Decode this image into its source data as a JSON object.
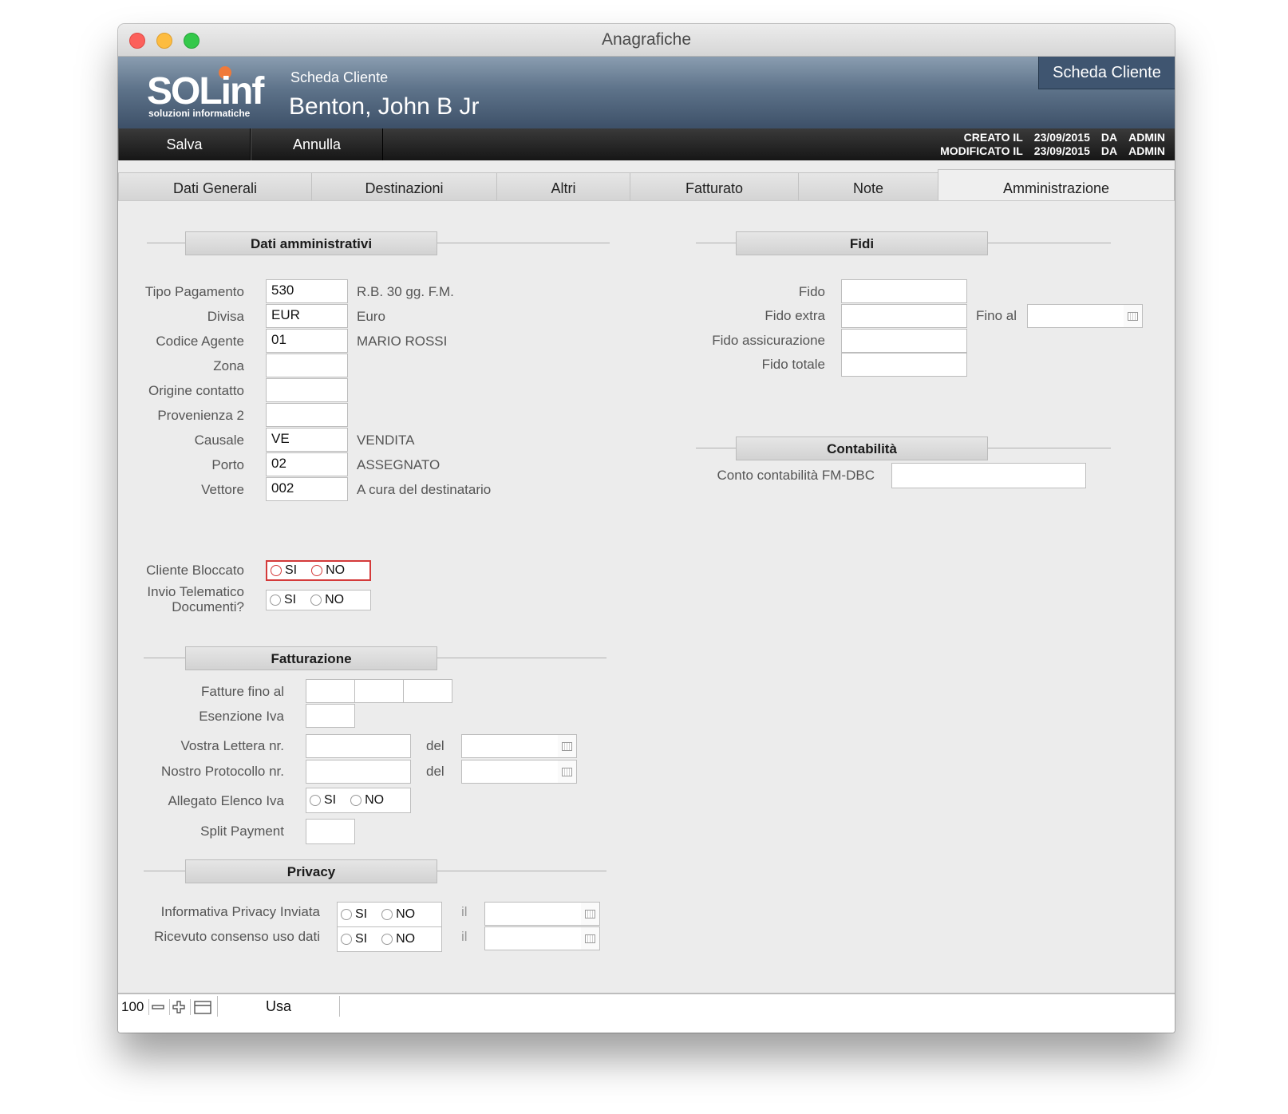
{
  "window": {
    "title": "Anagrafiche"
  },
  "banner": {
    "logo_text": "SOLinf",
    "logo_sub": "soluzioni informatiche",
    "subtitle": "Scheda Cliente",
    "name": "Benton, John B Jr",
    "badge": "Scheda Cliente"
  },
  "toolbar": {
    "save_label": "Salva",
    "cancel_label": "Annulla",
    "created_label": "CREATO IL",
    "created_date": "23/09/2015",
    "created_by_label": "DA",
    "created_by": "ADMIN",
    "modified_label": "MODIFICATO IL",
    "modified_date": "23/09/2015",
    "modified_by_label": "DA",
    "modified_by": "ADMIN"
  },
  "tabs": [
    "Dati Generali",
    "Destinazioni",
    "Altri",
    "Fatturato",
    "Note",
    "Amministrazione"
  ],
  "active_tab": "Amministrazione",
  "dati_amm": {
    "title": "Dati amministrativi",
    "rows": [
      {
        "label": "Tipo Pagamento",
        "value": "530",
        "desc": "R.B. 30 gg. F.M."
      },
      {
        "label": "Divisa",
        "value": "EUR",
        "desc": "Euro"
      },
      {
        "label": "Codice Agente",
        "value": "01",
        "desc": "MARIO ROSSI"
      },
      {
        "label": "Zona",
        "value": "",
        "desc": ""
      },
      {
        "label": "Origine contatto",
        "value": "",
        "desc": ""
      },
      {
        "label": "Provenienza 2",
        "value": "",
        "desc": ""
      },
      {
        "label": "Causale",
        "value": "VE",
        "desc": "VENDITA"
      },
      {
        "label": "Porto",
        "value": "02",
        "desc": "ASSEGNATO"
      },
      {
        "label": "Vettore",
        "value": "002",
        "desc": "A cura del destinatario"
      }
    ],
    "cliente_bloccato": {
      "label": "Cliente Bloccato",
      "yes": "SI",
      "no": "NO"
    },
    "invio_telematico": {
      "label_1": "Invio Telematico",
      "label_2": "Documenti?",
      "yes": "SI",
      "no": "NO"
    }
  },
  "fatturazione": {
    "title": "Fatturazione",
    "fatture_fino_al": "Fatture fino al",
    "esenzione_iva": "Esenzione Iva",
    "vostra_lettera": "Vostra Lettera nr.",
    "nostro_protocollo": "Nostro Protocollo nr.",
    "del_1": "del",
    "del_2": "del",
    "allegato": {
      "label": "Allegato Elenco Iva",
      "yes": "SI",
      "no": "NO"
    },
    "split_payment": "Split Payment"
  },
  "privacy": {
    "title": "Privacy",
    "informativa": {
      "label": "Informativa Privacy Inviata",
      "yes": "SI",
      "no": "NO",
      "il": "il"
    },
    "consenso": {
      "label": "Ricevuto consenso uso dati",
      "yes": "SI",
      "no": "NO",
      "il": "il"
    }
  },
  "fidi": {
    "title": "Fidi",
    "fido": "Fido",
    "fido_extra": "Fido extra",
    "fino_al": "Fino al",
    "fido_assicurazione": "Fido assicurazione",
    "fido_totale": "Fido totale"
  },
  "contabilita": {
    "title": "Contabilità",
    "conto_label": "Conto contabilità FM-DBC"
  },
  "statusbar": {
    "zoom": "100",
    "mode": "Usa"
  }
}
